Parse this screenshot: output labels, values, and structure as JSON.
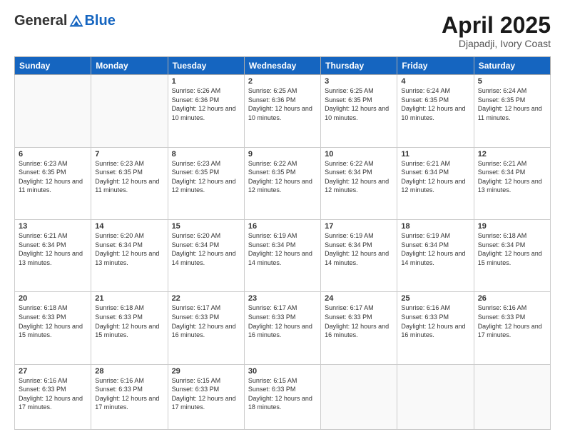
{
  "header": {
    "logo_general": "General",
    "logo_blue": "Blue",
    "month_year": "April 2025",
    "location": "Djapadji, Ivory Coast"
  },
  "days_of_week": [
    "Sunday",
    "Monday",
    "Tuesday",
    "Wednesday",
    "Thursday",
    "Friday",
    "Saturday"
  ],
  "weeks": [
    [
      {
        "day": "",
        "info": ""
      },
      {
        "day": "",
        "info": ""
      },
      {
        "day": "1",
        "info": "Sunrise: 6:26 AM\nSunset: 6:36 PM\nDaylight: 12 hours and 10 minutes."
      },
      {
        "day": "2",
        "info": "Sunrise: 6:25 AM\nSunset: 6:36 PM\nDaylight: 12 hours and 10 minutes."
      },
      {
        "day": "3",
        "info": "Sunrise: 6:25 AM\nSunset: 6:35 PM\nDaylight: 12 hours and 10 minutes."
      },
      {
        "day": "4",
        "info": "Sunrise: 6:24 AM\nSunset: 6:35 PM\nDaylight: 12 hours and 10 minutes."
      },
      {
        "day": "5",
        "info": "Sunrise: 6:24 AM\nSunset: 6:35 PM\nDaylight: 12 hours and 11 minutes."
      }
    ],
    [
      {
        "day": "6",
        "info": "Sunrise: 6:23 AM\nSunset: 6:35 PM\nDaylight: 12 hours and 11 minutes."
      },
      {
        "day": "7",
        "info": "Sunrise: 6:23 AM\nSunset: 6:35 PM\nDaylight: 12 hours and 11 minutes."
      },
      {
        "day": "8",
        "info": "Sunrise: 6:23 AM\nSunset: 6:35 PM\nDaylight: 12 hours and 12 minutes."
      },
      {
        "day": "9",
        "info": "Sunrise: 6:22 AM\nSunset: 6:35 PM\nDaylight: 12 hours and 12 minutes."
      },
      {
        "day": "10",
        "info": "Sunrise: 6:22 AM\nSunset: 6:34 PM\nDaylight: 12 hours and 12 minutes."
      },
      {
        "day": "11",
        "info": "Sunrise: 6:21 AM\nSunset: 6:34 PM\nDaylight: 12 hours and 12 minutes."
      },
      {
        "day": "12",
        "info": "Sunrise: 6:21 AM\nSunset: 6:34 PM\nDaylight: 12 hours and 13 minutes."
      }
    ],
    [
      {
        "day": "13",
        "info": "Sunrise: 6:21 AM\nSunset: 6:34 PM\nDaylight: 12 hours and 13 minutes."
      },
      {
        "day": "14",
        "info": "Sunrise: 6:20 AM\nSunset: 6:34 PM\nDaylight: 12 hours and 13 minutes."
      },
      {
        "day": "15",
        "info": "Sunrise: 6:20 AM\nSunset: 6:34 PM\nDaylight: 12 hours and 14 minutes."
      },
      {
        "day": "16",
        "info": "Sunrise: 6:19 AM\nSunset: 6:34 PM\nDaylight: 12 hours and 14 minutes."
      },
      {
        "day": "17",
        "info": "Sunrise: 6:19 AM\nSunset: 6:34 PM\nDaylight: 12 hours and 14 minutes."
      },
      {
        "day": "18",
        "info": "Sunrise: 6:19 AM\nSunset: 6:34 PM\nDaylight: 12 hours and 14 minutes."
      },
      {
        "day": "19",
        "info": "Sunrise: 6:18 AM\nSunset: 6:34 PM\nDaylight: 12 hours and 15 minutes."
      }
    ],
    [
      {
        "day": "20",
        "info": "Sunrise: 6:18 AM\nSunset: 6:33 PM\nDaylight: 12 hours and 15 minutes."
      },
      {
        "day": "21",
        "info": "Sunrise: 6:18 AM\nSunset: 6:33 PM\nDaylight: 12 hours and 15 minutes."
      },
      {
        "day": "22",
        "info": "Sunrise: 6:17 AM\nSunset: 6:33 PM\nDaylight: 12 hours and 16 minutes."
      },
      {
        "day": "23",
        "info": "Sunrise: 6:17 AM\nSunset: 6:33 PM\nDaylight: 12 hours and 16 minutes."
      },
      {
        "day": "24",
        "info": "Sunrise: 6:17 AM\nSunset: 6:33 PM\nDaylight: 12 hours and 16 minutes."
      },
      {
        "day": "25",
        "info": "Sunrise: 6:16 AM\nSunset: 6:33 PM\nDaylight: 12 hours and 16 minutes."
      },
      {
        "day": "26",
        "info": "Sunrise: 6:16 AM\nSunset: 6:33 PM\nDaylight: 12 hours and 17 minutes."
      }
    ],
    [
      {
        "day": "27",
        "info": "Sunrise: 6:16 AM\nSunset: 6:33 PM\nDaylight: 12 hours and 17 minutes."
      },
      {
        "day": "28",
        "info": "Sunrise: 6:16 AM\nSunset: 6:33 PM\nDaylight: 12 hours and 17 minutes."
      },
      {
        "day": "29",
        "info": "Sunrise: 6:15 AM\nSunset: 6:33 PM\nDaylight: 12 hours and 17 minutes."
      },
      {
        "day": "30",
        "info": "Sunrise: 6:15 AM\nSunset: 6:33 PM\nDaylight: 12 hours and 18 minutes."
      },
      {
        "day": "",
        "info": ""
      },
      {
        "day": "",
        "info": ""
      },
      {
        "day": "",
        "info": ""
      }
    ]
  ]
}
